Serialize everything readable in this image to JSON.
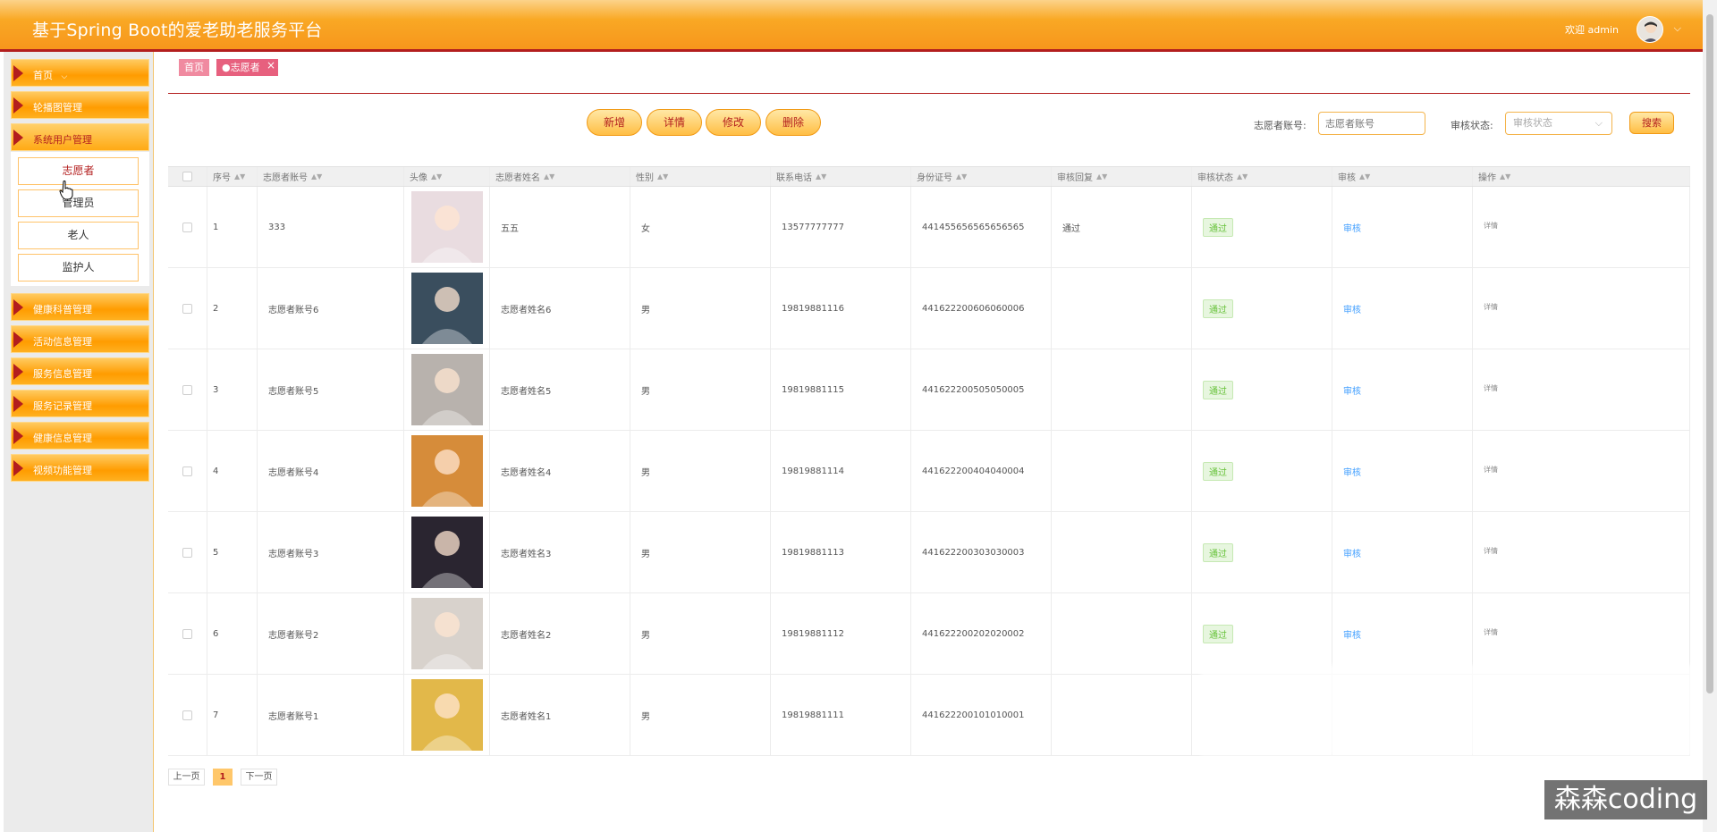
{
  "header": {
    "title": "基于Spring Boot的爱老助老服务平台",
    "welcome": "欢迎 admin",
    "chevron": "⌵"
  },
  "sidebar": {
    "items": [
      {
        "label": "首页"
      },
      {
        "label": "轮播图管理"
      },
      {
        "label": "系统用户管理"
      },
      {
        "label": "健康科普管理"
      },
      {
        "label": "活动信息管理"
      },
      {
        "label": "服务信息管理"
      },
      {
        "label": "服务记录管理"
      },
      {
        "label": "健康信息管理"
      },
      {
        "label": "视频功能管理"
      }
    ],
    "home_chevron": "⌵",
    "submenu": [
      "志愿者",
      "管理员",
      "老人",
      "监护人"
    ]
  },
  "breadcrumb": {
    "home": "首页",
    "current": "●志愿者",
    "close": "×"
  },
  "actions": {
    "add": "新增",
    "detail": "详情",
    "edit": "修改",
    "delete": "删除"
  },
  "search": {
    "account_label": "志愿者账号:",
    "account_placeholder": "志愿者账号",
    "status_label": "审核状态:",
    "status_placeholder": "审核状态",
    "button": "搜索"
  },
  "table": {
    "columns": [
      "序号",
      "志愿者账号",
      "头像",
      "志愿者姓名",
      "性别",
      "联系电话",
      "身份证号",
      "审核回复",
      "审核状态",
      "审核",
      "操作"
    ],
    "sort_icon": "▲▼",
    "rows": [
      {
        "index": "1",
        "account": "333",
        "name": "五五",
        "gender": "女",
        "phone": "13577777777",
        "id_card": "441455656565656565",
        "reply": "通过",
        "status": "通过",
        "audit": "审核",
        "op": "详情",
        "avatar_color": "#e9dce0"
      },
      {
        "index": "2",
        "account": "志愿者账号6",
        "name": "志愿者姓名6",
        "gender": "男",
        "phone": "19819881116",
        "id_card": "441622200606060006",
        "reply": "",
        "status": "通过",
        "audit": "审核",
        "op": "详情",
        "avatar_color": "#3a4e5e"
      },
      {
        "index": "3",
        "account": "志愿者账号5",
        "name": "志愿者姓名5",
        "gender": "男",
        "phone": "19819881115",
        "id_card": "441622200505050005",
        "reply": "",
        "status": "通过",
        "audit": "审核",
        "op": "详情",
        "avatar_color": "#b8b2ad"
      },
      {
        "index": "4",
        "account": "志愿者账号4",
        "name": "志愿者姓名4",
        "gender": "男",
        "phone": "19819881114",
        "id_card": "441622200404040004",
        "reply": "",
        "status": "通过",
        "audit": "审核",
        "op": "详情",
        "avatar_color": "#d68c3a"
      },
      {
        "index": "5",
        "account": "志愿者账号3",
        "name": "志愿者姓名3",
        "gender": "男",
        "phone": "19819881113",
        "id_card": "441622200303030003",
        "reply": "",
        "status": "通过",
        "audit": "审核",
        "op": "详情",
        "avatar_color": "#2a2530"
      },
      {
        "index": "6",
        "account": "志愿者账号2",
        "name": "志愿者姓名2",
        "gender": "男",
        "phone": "19819881112",
        "id_card": "441622200202020002",
        "reply": "",
        "status": "通过",
        "audit": "审核",
        "op": "详情",
        "avatar_color": "#d8d2cc"
      },
      {
        "index": "7",
        "account": "志愿者账号1",
        "name": "志愿者姓名1",
        "gender": "男",
        "phone": "19819881111",
        "id_card": "441622200101010001",
        "reply": "",
        "status": "",
        "audit": "",
        "op": "",
        "avatar_color": "#e2b84a"
      }
    ]
  },
  "pagination": {
    "prev": "上一页",
    "current": "1",
    "next": "下一页"
  },
  "watermark": "森森coding",
  "colors": {
    "header_orange": "#f9a824",
    "accent_red": "#b31e1e",
    "menu_orange": "#ff9c00",
    "tag_pink": "#e65b7a",
    "success_green": "#67c23a",
    "link_blue": "#409eff"
  }
}
